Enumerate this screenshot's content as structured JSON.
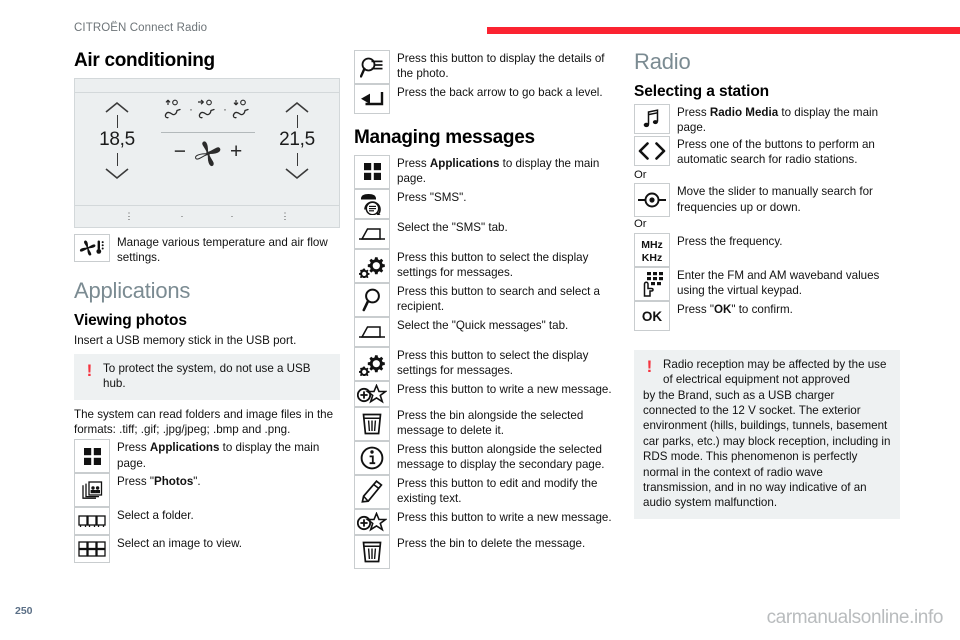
{
  "header": {
    "title": "CITROËN Connect Radio",
    "rule_color": "#fb2331"
  },
  "footer": {
    "page_number": "250",
    "watermark": "carmanualsonline.info"
  },
  "column1": {
    "heading": "Air conditioning",
    "ac_panel": {
      "left_temperature": "18,5",
      "right_temperature": "21,5",
      "airflow_icons": [
        "airflow-up-icon",
        "airflow-face-icon",
        "airflow-down-icon"
      ],
      "fan_icon": "fan-icon",
      "minus_label": "−",
      "plus_label": "+",
      "separator_dot": "·",
      "bottom_markers": [
        "⋮",
        "·",
        "·",
        "⋮"
      ]
    },
    "ac_row": {
      "icon": "fan-thermometer-icon",
      "text": "Manage various temperature and air flow settings."
    },
    "applications_heading": "Applications",
    "viewing_photos_heading": "Viewing photos",
    "usb_intro": "Insert a USB memory stick in the USB port.",
    "warning": {
      "bang": "!",
      "text": "To protect the system, do not use a USB hub."
    },
    "formats_text": "The system can read folders and image files in the formats: .tiff; .gif; .jpg/jpeg; .bmp and .png.",
    "rows": [
      {
        "icon": "apps-grid-icon",
        "text_prefix": "Press ",
        "text_bold": "Applications",
        "text_suffix": " to display the main page."
      },
      {
        "icon": "photos-icon",
        "text_prefix": "Press \"",
        "text_bold": "Photos",
        "text_suffix": "\"."
      },
      {
        "icon": "folder-row-icon",
        "text_prefix": "Select a folder.",
        "text_bold": "",
        "text_suffix": ""
      },
      {
        "icon": "image-grid-icon",
        "text_prefix": "Select an image to view.",
        "text_bold": "",
        "text_suffix": ""
      }
    ]
  },
  "column2": {
    "top_rows": [
      {
        "icon": "photo-details-icon",
        "text_prefix": "Press this button to display the details of the photo.",
        "text_bold": "",
        "text_suffix": ""
      },
      {
        "icon": "back-arrow-icon",
        "text_prefix": "Press the back arrow to go back a level.",
        "text_bold": "",
        "text_suffix": ""
      }
    ],
    "managing_messages_heading": "Managing messages",
    "rows": [
      {
        "icon": "apps-grid-icon",
        "text_prefix": "Press ",
        "text_bold": "Applications",
        "text_suffix": " to display the main page."
      },
      {
        "icon": "sms-bubble-icon",
        "text_prefix": "Press \"SMS\".",
        "text_bold": "",
        "text_suffix": ""
      },
      {
        "icon": "tab-icon",
        "text_prefix": "Select the \"SMS\" tab.",
        "text_bold": "",
        "text_suffix": ""
      },
      {
        "icon": "settings-gear-icon",
        "text_prefix": "Press this button to select the display settings for messages.",
        "text_bold": "",
        "text_suffix": ""
      },
      {
        "icon": "magnifier-icon",
        "text_prefix": "Press this button to search and select a recipient.",
        "text_bold": "",
        "text_suffix": ""
      },
      {
        "icon": "tab-icon",
        "text_prefix": "Select the \"Quick messages\" tab.",
        "text_bold": "",
        "text_suffix": ""
      },
      {
        "icon": "settings-gear-icon",
        "text_prefix": "Press this button to select the display settings for messages.",
        "text_bold": "",
        "text_suffix": ""
      },
      {
        "icon": "new-message-icon",
        "text_prefix": "Press this button to write a new message.",
        "text_bold": "",
        "text_suffix": ""
      },
      {
        "icon": "bin-icon",
        "text_prefix": "Press the bin alongside the selected message to delete it.",
        "text_bold": "",
        "text_suffix": ""
      },
      {
        "icon": "info-icon",
        "text_prefix": "Press this button alongside the selected message to display the secondary page.",
        "text_bold": "",
        "text_suffix": ""
      },
      {
        "icon": "pencil-icon",
        "text_prefix": "Press this button to edit and modify the existing text.",
        "text_bold": "",
        "text_suffix": ""
      },
      {
        "icon": "new-message-icon",
        "text_prefix": "Press this button to write a new message.",
        "text_bold": "",
        "text_suffix": ""
      },
      {
        "icon": "bin-icon",
        "text_prefix": "Press the bin to delete the message.",
        "text_bold": "",
        "text_suffix": ""
      }
    ]
  },
  "column3": {
    "heading": "Radio",
    "selecting_heading": "Selecting a station",
    "rows": [
      {
        "icon": "music-note-icon",
        "text_prefix": "Press ",
        "text_bold": "Radio Media",
        "text_suffix": " to display the main page."
      },
      {
        "icon": "prev-next-arrows-icon",
        "text_prefix": "Press one of the buttons to perform an automatic search for radio stations.",
        "text_bold": "",
        "text_suffix": ""
      }
    ],
    "or_label_1": "Or",
    "slider_row": {
      "icon": "slider-icon",
      "text": "Move the slider to manually search for frequencies up or down."
    },
    "or_label_2": "Or",
    "freq_rows": [
      {
        "icon": "mhz-khz-icon",
        "icon_label_top": "MHz",
        "icon_label_bottom": "KHz",
        "text_prefix": "Press the frequency.",
        "text_bold": "",
        "text_suffix": ""
      },
      {
        "icon": "virtual-keypad-icon",
        "text_prefix": "Enter the FM and AM waveband values using the virtual keypad.",
        "text_bold": "",
        "text_suffix": ""
      },
      {
        "icon": "ok-button-icon",
        "icon_label": "OK",
        "text_prefix": "Press \"",
        "text_bold": "OK",
        "text_suffix": "\" to confirm."
      }
    ],
    "warning": {
      "bang": "!",
      "text": "Radio reception may be affected by the use of electrical equipment not approved",
      "continuation": "by the Brand, such as a USB charger connected to the 12 V socket. The exterior environment (hills, buildings, tunnels, basement car parks, etc.) may block reception, including in RDS mode. This phenomenon is perfectly normal in the context of radio wave transmission, and in no way indicative of an audio system malfunction."
    }
  }
}
